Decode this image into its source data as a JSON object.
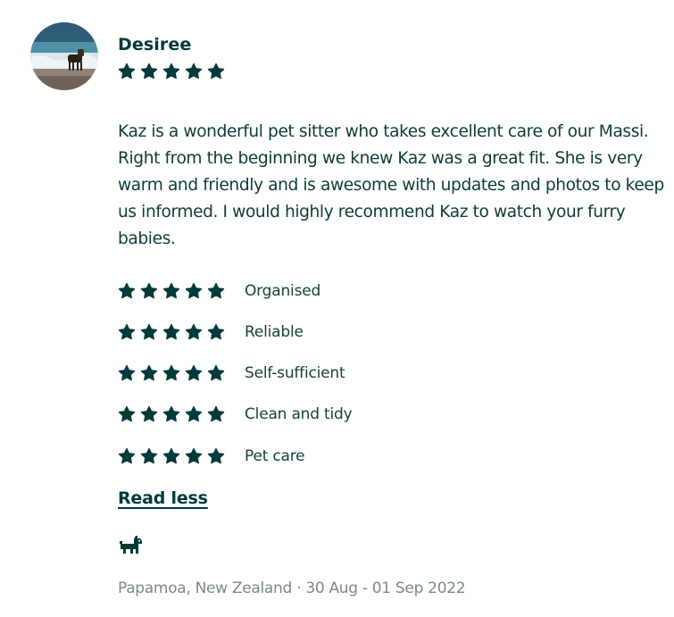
{
  "reviewer": {
    "name": "Desiree",
    "overall_rating": 5,
    "avatar_icon": "avatar-photo-dog-on-beach"
  },
  "review": {
    "text": "Kaz is a wonderful pet sitter who takes excellent care of our Massi. Right from the beginning we knew Kaz was a great fit. She is very warm and friendly and is awesome with updates and photos to keep us informed. I would highly recommend Kaz to watch your furry babies."
  },
  "ratings": [
    {
      "label": "Organised",
      "stars": 5
    },
    {
      "label": "Reliable",
      "stars": 5
    },
    {
      "label": "Self-sufficient",
      "stars": 5
    },
    {
      "label": "Clean and tidy",
      "stars": 5
    },
    {
      "label": "Pet care",
      "stars": 5
    }
  ],
  "actions": {
    "read_less_label": "Read less"
  },
  "pet_icon": "dog-icon",
  "meta": {
    "location_dates": "Papamoa, New Zealand · 30 Aug - 01 Sep 2022"
  },
  "colors": {
    "primary": "#003a3a",
    "text": "#0d3b3b",
    "muted": "#7a8a8a",
    "star": "#003a3a"
  }
}
